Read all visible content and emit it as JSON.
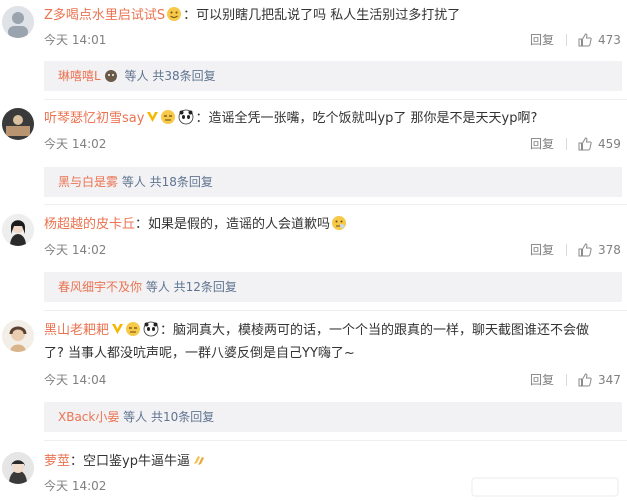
{
  "comments": [
    {
      "username": "Z多喝点水里启试试S",
      "text": "：可以别瞎几把乱说了吗 私人生活别过多打扰了",
      "time": "今天 14:01",
      "reply_label": "回复",
      "likes": "473",
      "sub": {
        "name": "琳嘻嘻L",
        "mid": " 等人 ",
        "count": "共38条回复"
      }
    },
    {
      "username": "听琴瑟忆初雪say",
      "text": "：造谣全凭一张嘴，吃个饭就叫yp了 那你是不是天天yp啊?",
      "time": "今天 14:02",
      "reply_label": "回复",
      "likes": "459",
      "sub": {
        "name": "黑与白是雾",
        "mid": " 等人 ",
        "count": "共18条回复"
      }
    },
    {
      "username": "杨超越的皮卡丘",
      "text": "：如果是假的，造谣的人会道歉吗",
      "time": "今天 14:02",
      "reply_label": "回复",
      "likes": "378",
      "sub": {
        "name": "春风细宇不及你",
        "mid": " 等人 ",
        "count": "共12条回复"
      }
    },
    {
      "username": "黑山老耙耙",
      "text": "：脑洞真大，模棱两可的话，一个个当的跟真的一样，聊天截图谁还不会做",
      "text2": "了? 当事人都没吭声呢，一群八婆反倒是自己YY嗨了~",
      "time": "今天 14:04",
      "reply_label": "回复",
      "likes": "347",
      "sub": {
        "name": "XBack小晏",
        "mid": " 等人 ",
        "count": "共10条回复"
      }
    },
    {
      "username": "萝莖",
      "text": "：空口鉴yp牛逼牛逼",
      "time": "今天 14:02"
    }
  ],
  "colors": {
    "username": "#eb7350",
    "meta": "#808080",
    "reply_box": "#f2f2f5",
    "sub_text": "#5f7490"
  },
  "icons": {
    "like": "thumbs-up-icon",
    "badge": "vip-badge-icon"
  }
}
